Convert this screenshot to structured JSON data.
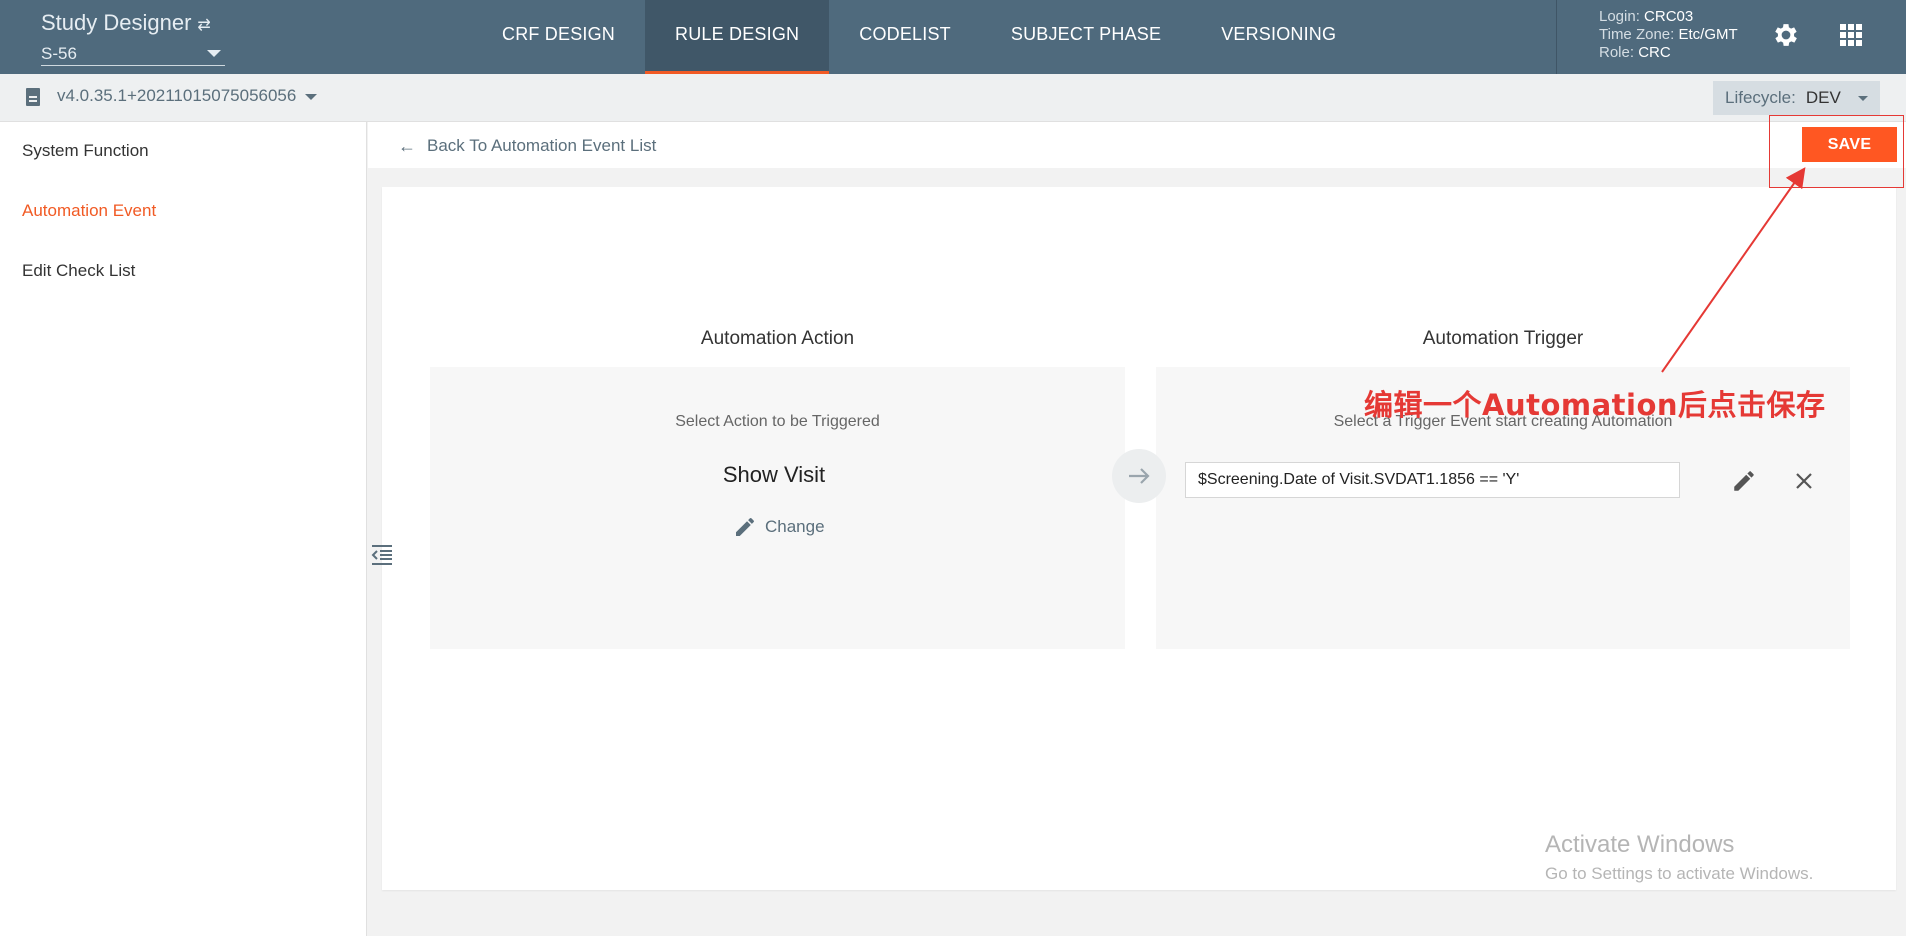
{
  "header": {
    "app_title": "Study Designer",
    "swap_glyph": "⇄",
    "study": "S-56",
    "nav": [
      "CRF DESIGN",
      "RULE DESIGN",
      "CODELIST",
      "SUBJECT PHASE",
      "VERSIONING"
    ],
    "active_nav": "RULE DESIGN",
    "login_label": "Login:",
    "login_value": "CRC03",
    "tz_label": "Time Zone:",
    "tz_value": "Etc/GMT",
    "role_label": "Role:",
    "role_value": "CRC",
    "icons": [
      "gear-icon",
      "apps-grid-icon"
    ]
  },
  "subbar": {
    "version": "v4.0.35.1+20211015075056056",
    "lifecycle_label": "Lifecycle:",
    "lifecycle_value": "DEV"
  },
  "sidebar": {
    "items": [
      "System Function",
      "Automation Event",
      "Edit Check List"
    ],
    "active": "Automation Event"
  },
  "main": {
    "back_label": "Back To Automation Event List",
    "save_label": "SAVE",
    "action_title": "Automation Action",
    "action_hint": "Select Action to be Triggered",
    "action_name": "Show Visit",
    "change_label": "Change",
    "trigger_title": "Automation Trigger",
    "trigger_hint": "Select a Trigger Event start creating Automation",
    "trigger_expression": "$Screening.Date of Visit.SVDAT1.1856 == 'Y'"
  },
  "annotation": {
    "text": "编辑一个Automation后点击保存",
    "color": "#e53935"
  },
  "watermark": {
    "line1": "Activate Windows",
    "line2": "Go to Settings to activate Windows."
  },
  "colors": {
    "header_bg": "#4f6a7d",
    "accent": "#f15a24",
    "save_button": "#ff5722"
  }
}
